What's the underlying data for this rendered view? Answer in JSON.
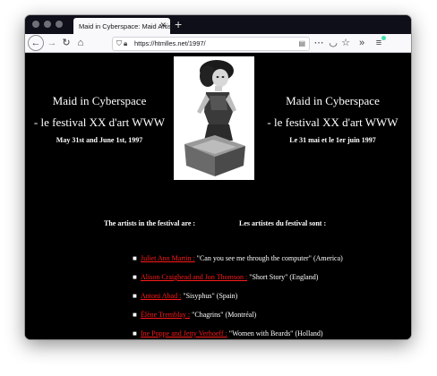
{
  "browser": {
    "tab_title": "Maid in Cyberspace: Maid Artists",
    "url": "https://htmlles.net/1997/"
  },
  "page": {
    "left": {
      "title": "Maid in Cyberspace",
      "subtitle": "- le festival XX d'art WWW",
      "date": "May 31st and June 1st, 1997"
    },
    "right": {
      "title": "Maid in Cyberspace",
      "subtitle": "- le festival XX d'art WWW",
      "date": "Le 31 mai et le 1er juin 1997"
    },
    "artists_heading_en": "The artists in the festival are :",
    "artists_heading_fr": "Les artistes du festival sont :",
    "artists": [
      {
        "name": "Juliet Ann Martin :",
        "work": " \"Can you see me through the computer\" (America)"
      },
      {
        "name": "Alison Craighead and Jon Thomson :",
        "work": " \"Short Story\" (England)"
      },
      {
        "name": "Antoni Abad :",
        "work": " \"Sisyphus\" (Spain)"
      },
      {
        "name": "Èlène Tremblay :",
        "work": " \"Chagrins\" (Montréal)"
      },
      {
        "name": "Ine Poppe and Jetty Verhoeff :",
        "work": " \"Women with Beards\" (Holland)"
      }
    ]
  },
  "colors": {
    "page_background": "#000000",
    "link": "#ff1a1a",
    "text": "#ffffff"
  }
}
